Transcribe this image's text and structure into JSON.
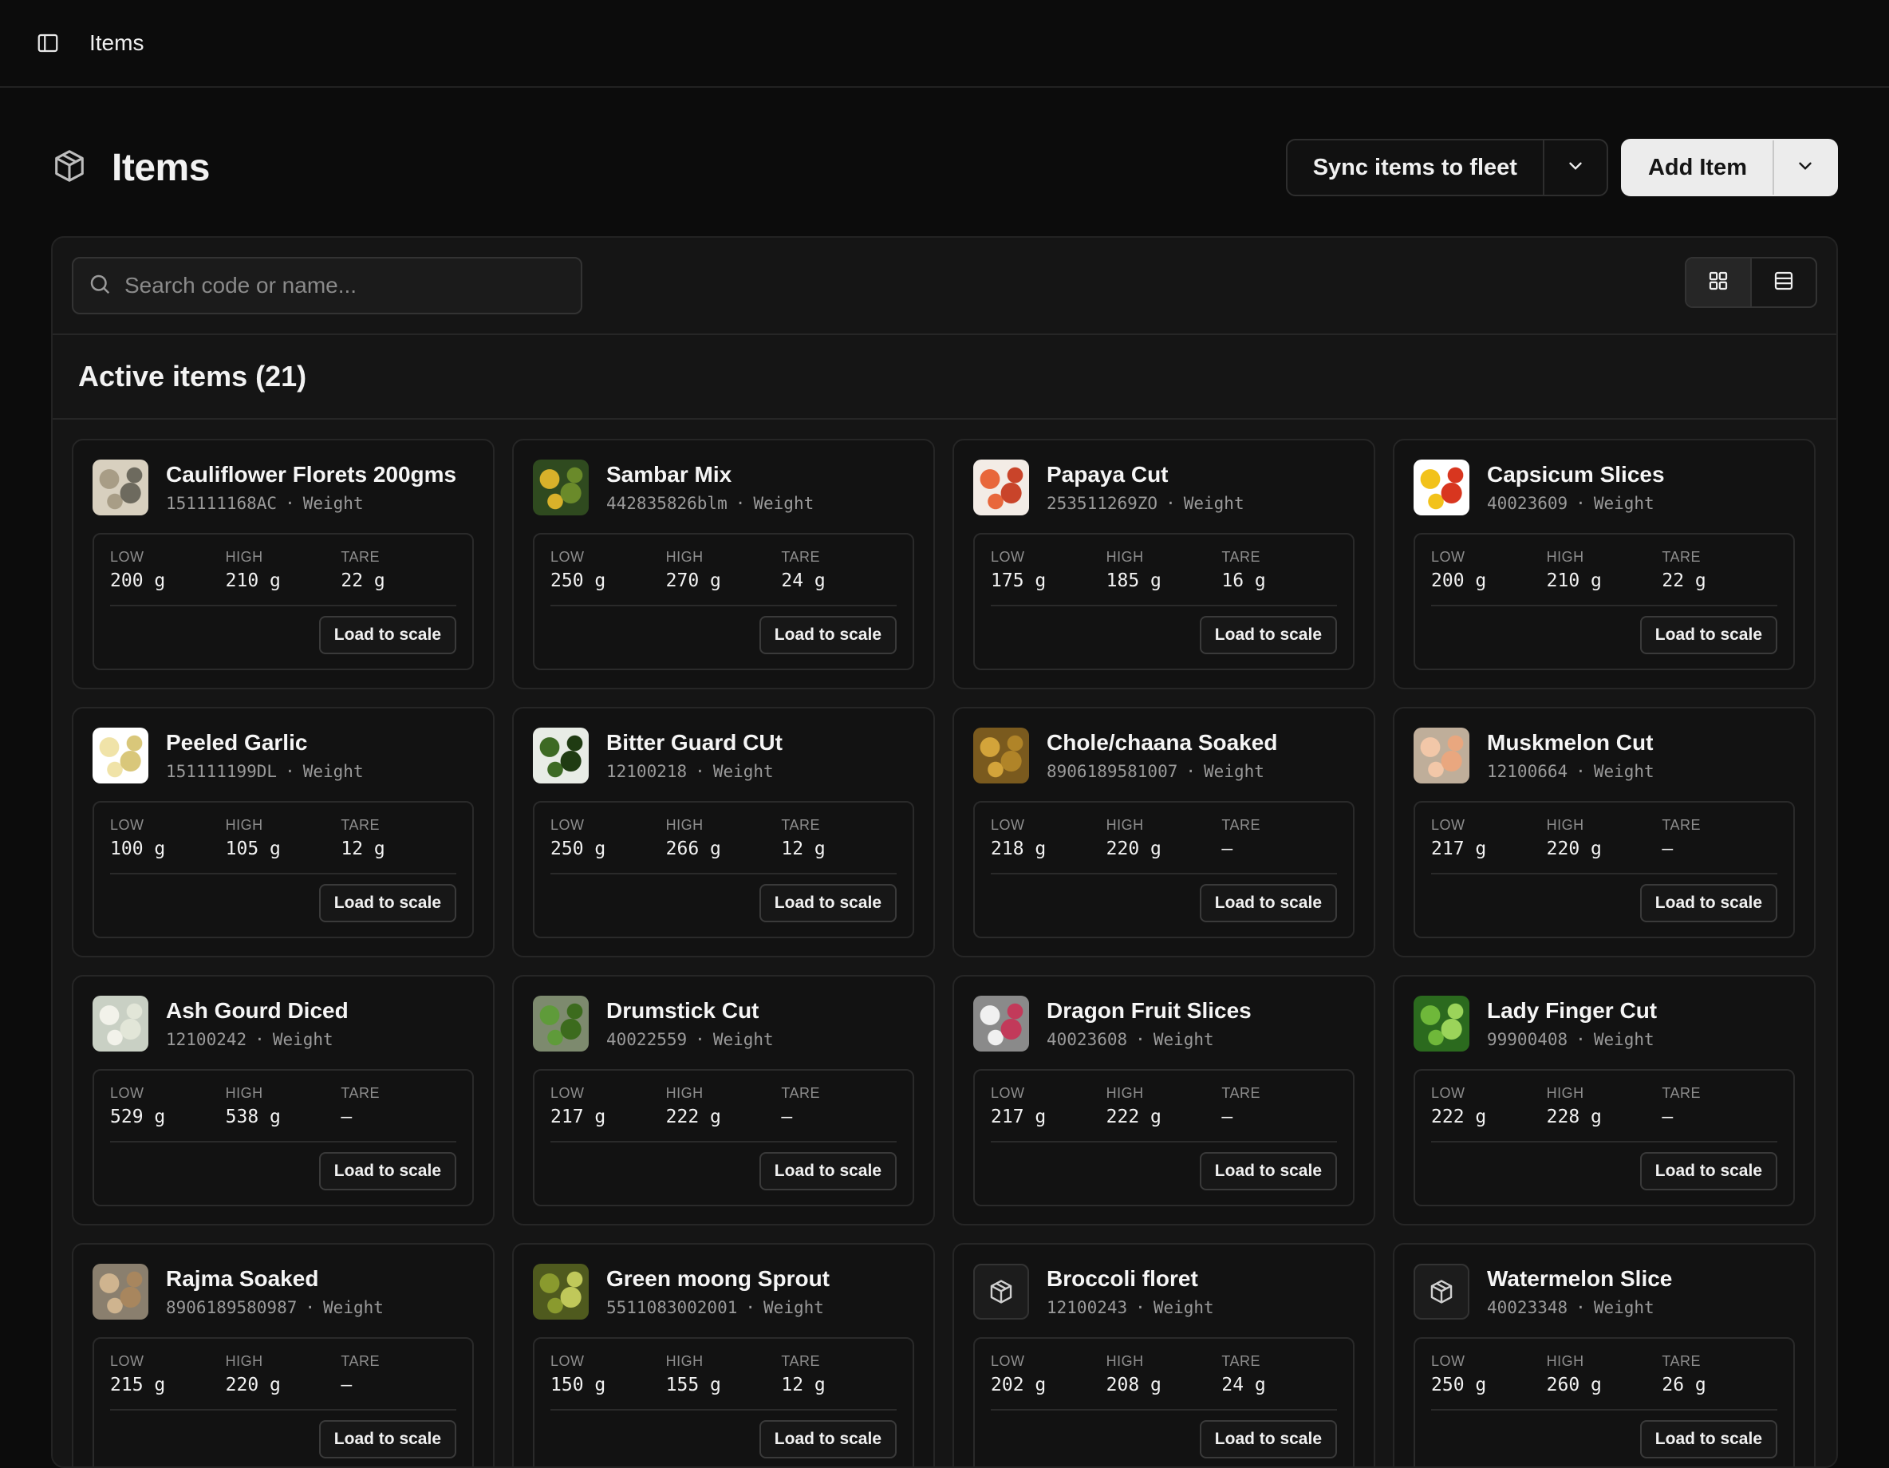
{
  "topbar": {
    "breadcrumb": "Items"
  },
  "header": {
    "title": "Items",
    "sync_label": "Sync items to fleet",
    "add_label": "Add Item"
  },
  "search": {
    "placeholder": "Search code or name..."
  },
  "section": {
    "title": "Active items (21)"
  },
  "labels": {
    "low": "LOW",
    "high": "HIGH",
    "tare": "TARE",
    "load": "Load to scale"
  },
  "items": [
    {
      "name": "Cauliflower Florets 200gms",
      "code": "151111168AC",
      "type": "Weight",
      "low": "200 g",
      "high": "210 g",
      "tare": "22 g",
      "thumb": "cauliflower"
    },
    {
      "name": "Sambar Mix",
      "code": "442835826blm",
      "type": "Weight",
      "low": "250 g",
      "high": "270 g",
      "tare": "24 g",
      "thumb": "sambar"
    },
    {
      "name": "Papaya Cut",
      "code": "253511269ZO",
      "type": "Weight",
      "low": "175 g",
      "high": "185 g",
      "tare": "16 g",
      "thumb": "papaya"
    },
    {
      "name": "Capsicum Slices",
      "code": "40023609",
      "type": "Weight",
      "low": "200 g",
      "high": "210 g",
      "tare": "22 g",
      "thumb": "capsicum"
    },
    {
      "name": "Peeled Garlic",
      "code": "151111199DL",
      "type": "Weight",
      "low": "100 g",
      "high": "105 g",
      "tare": "12 g",
      "thumb": "garlic"
    },
    {
      "name": "Bitter Guard CUt",
      "code": "12100218",
      "type": "Weight",
      "low": "250 g",
      "high": "266 g",
      "tare": "12 g",
      "thumb": "bitter"
    },
    {
      "name": "Chole/chaana Soaked",
      "code": "8906189581007",
      "type": "Weight",
      "low": "218 g",
      "high": "220 g",
      "tare": "—",
      "thumb": "chole"
    },
    {
      "name": "Muskmelon Cut",
      "code": "12100664",
      "type": "Weight",
      "low": "217 g",
      "high": "220 g",
      "tare": "—",
      "thumb": "muskmelon"
    },
    {
      "name": "Ash Gourd Diced",
      "code": "12100242",
      "type": "Weight",
      "low": "529 g",
      "high": "538 g",
      "tare": "—",
      "thumb": "ashgourd"
    },
    {
      "name": "Drumstick Cut",
      "code": "40022559",
      "type": "Weight",
      "low": "217 g",
      "high": "222 g",
      "tare": "—",
      "thumb": "drumstick"
    },
    {
      "name": "Dragon Fruit Slices",
      "code": "40023608",
      "type": "Weight",
      "low": "217 g",
      "high": "222 g",
      "tare": "—",
      "thumb": "dragon"
    },
    {
      "name": "Lady Finger Cut",
      "code": "99900408",
      "type": "Weight",
      "low": "222 g",
      "high": "228 g",
      "tare": "—",
      "thumb": "ladyfinger"
    },
    {
      "name": "Rajma Soaked",
      "code": "8906189580987",
      "type": "Weight",
      "low": "215 g",
      "high": "220 g",
      "tare": "—",
      "thumb": "rajma"
    },
    {
      "name": "Green moong Sprout",
      "code": "5511083002001",
      "type": "Weight",
      "low": "150 g",
      "high": "155 g",
      "tare": "12 g",
      "thumb": "moong"
    },
    {
      "name": "Broccoli floret",
      "code": "12100243",
      "type": "Weight",
      "low": "202 g",
      "high": "208 g",
      "tare": "24 g",
      "thumb": "package-icon"
    },
    {
      "name": "Watermelon Slice",
      "code": "40023348",
      "type": "Weight",
      "low": "250 g",
      "high": "260 g",
      "tare": "26 g",
      "thumb": "package-icon"
    }
  ],
  "thumb_colors": {
    "cauliflower": [
      "#d8d0bf",
      "#a89d86",
      "#6d6a5e"
    ],
    "sambar": [
      "#2f4a1f",
      "#d8b12a",
      "#6a8a2a"
    ],
    "papaya": [
      "#f3ece6",
      "#e8673b",
      "#c9442a"
    ],
    "capsicum": [
      "#ffffff",
      "#f2c21a",
      "#d8361f"
    ],
    "garlic": [
      "#ffffff",
      "#f0e3a8",
      "#d9c77a"
    ],
    "bitter": [
      "#e8ece6",
      "#3d6a24",
      "#1f3b12"
    ],
    "chole": [
      "#7a5a1e",
      "#d3a43a",
      "#b08428"
    ],
    "muskmelon": [
      "#bfae9a",
      "#f2c7a8",
      "#e9a77f"
    ],
    "ashgourd": [
      "#c9d0c4",
      "#f2f2ea",
      "#e2e6d8"
    ],
    "drumstick": [
      "#7d8a6e",
      "#5f9b3a",
      "#3c6b1d"
    ],
    "dragon": [
      "#8a8a8a",
      "#f0f0f0",
      "#c23a5a"
    ],
    "ladyfinger": [
      "#2b6a1e",
      "#6fb83a",
      "#9bd45a"
    ],
    "rajma": [
      "#8a7f6e",
      "#cfb48f",
      "#a8865e"
    ],
    "moong": [
      "#4f5a1e",
      "#8a9a2e",
      "#c0c85a"
    ]
  }
}
